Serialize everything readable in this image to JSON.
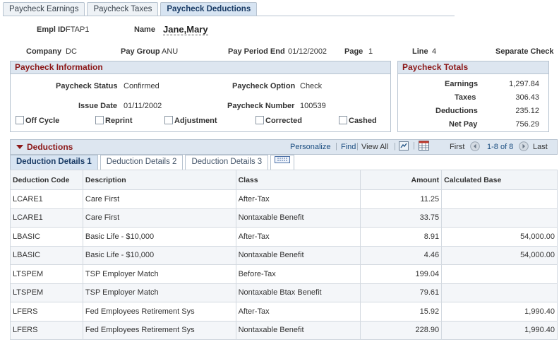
{
  "tabs": [
    "Paycheck Earnings",
    "Paycheck Taxes",
    "Paycheck Deductions"
  ],
  "header": {
    "empl_id_label": "Empl ID",
    "empl_id": "FTAP1",
    "name_label": "Name",
    "name": "Jane,Mary",
    "company_label": "Company",
    "company": "DC",
    "pay_group_label": "Pay Group",
    "pay_group": "ANU",
    "pay_period_end_label": "Pay Period End",
    "pay_period_end": "01/12/2002",
    "page_label": "Page",
    "page": "1",
    "line_label": "Line",
    "line": "4",
    "separate_check_label": "Separate Check"
  },
  "paycheck_info": {
    "title": "Paycheck Information",
    "status_label": "Paycheck Status",
    "status": "Confirmed",
    "option_label": "Paycheck Option",
    "option": "Check",
    "issue_date_label": "Issue Date",
    "issue_date": "01/11/2002",
    "number_label": "Paycheck Number",
    "number": "100539",
    "checkboxes": [
      "Off Cycle",
      "Reprint",
      "Adjustment",
      "Corrected",
      "Cashed"
    ]
  },
  "paycheck_totals": {
    "title": "Paycheck Totals",
    "earnings_label": "Earnings",
    "earnings": "1,297.84",
    "taxes_label": "Taxes",
    "taxes": "306.43",
    "deductions_label": "Deductions",
    "deductions": "235.12",
    "net_pay_label": "Net Pay",
    "net_pay": "756.29"
  },
  "deductions": {
    "title": "Deductions",
    "personalize": "Personalize",
    "find": "Find",
    "view_all": "View All",
    "first": "First",
    "range": "1-8 of 8",
    "last": "Last",
    "subtabs": [
      "Deduction Details 1",
      "Deduction Details 2",
      "Deduction Details 3"
    ],
    "columns": [
      "Deduction Code",
      "Description",
      "Class",
      "Amount",
      "Calculated Base"
    ],
    "rows": [
      [
        "LCARE1",
        "Care First",
        "After-Tax",
        "11.25",
        ""
      ],
      [
        "LCARE1",
        "Care First",
        "Nontaxable Benefit",
        "33.75",
        ""
      ],
      [
        "LBASIC",
        "Basic Life - $10,000",
        "After-Tax",
        "8.91",
        "54,000.00"
      ],
      [
        "LBASIC",
        "Basic Life - $10,000",
        "Nontaxable Benefit",
        "4.46",
        "54,000.00"
      ],
      [
        "LTSPEM",
        "TSP Employer Match",
        "Before-Tax",
        "199.04",
        ""
      ],
      [
        "LTSPEM",
        "TSP Employer Match",
        "Nontaxable Btax Benefit",
        "79.61",
        ""
      ],
      [
        "LFERS",
        "Fed Employees Retirement Sys",
        "After-Tax",
        "15.92",
        "1,990.40"
      ],
      [
        "LFERS",
        "Fed Employees Retirement Sys",
        "Nontaxable Benefit",
        "228.90",
        "1,990.40"
      ]
    ]
  },
  "colors": {
    "accent_header": "#dde6f0",
    "title_red": "#8c1818",
    "link_blue": "#1a4d80"
  }
}
